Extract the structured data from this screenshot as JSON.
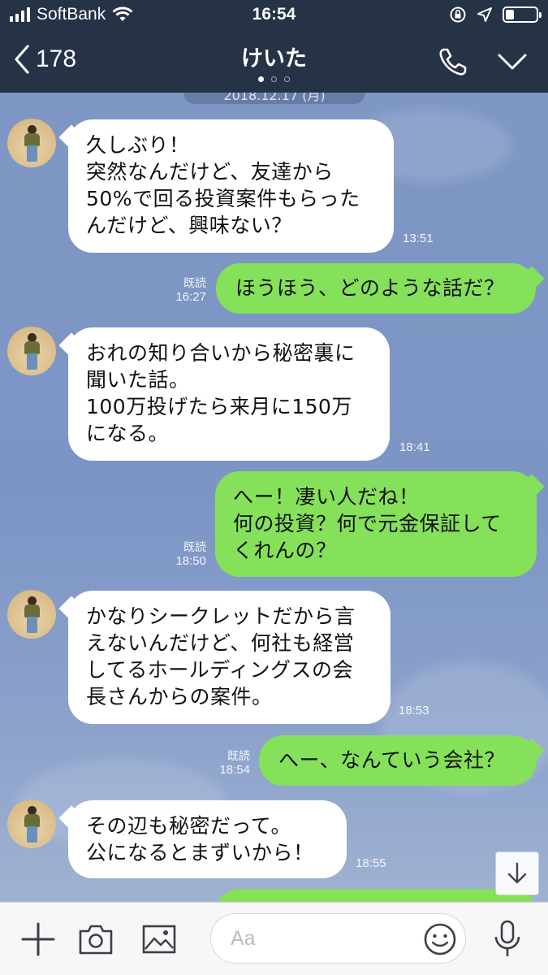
{
  "status_bar": {
    "carrier": "SoftBank",
    "time": "16:54",
    "signal_bars": 4,
    "battery_level_percent": 28,
    "icons": [
      "signal-icon",
      "wifi-icon",
      "orientation-lock-icon",
      "location-icon",
      "battery-icon"
    ]
  },
  "header": {
    "back_count": "178",
    "title": "けいた",
    "page_dots": 3,
    "active_dot": 0,
    "icons": [
      "back-chevron-icon",
      "phone-icon",
      "chevron-down-icon"
    ]
  },
  "chat": {
    "date_divider": "2018.12.17 (月)",
    "messages": [
      {
        "direction": "in",
        "lines": [
          "久しぶり！",
          "突然なんだけど、友達から",
          "50%で回る投資案件もらった",
          "んだけど、興味ない？"
        ],
        "time": "13:51"
      },
      {
        "direction": "out",
        "lines": [
          "ほうほう、どのような話だ？"
        ],
        "read": "既読",
        "time": "16:27"
      },
      {
        "direction": "in",
        "lines": [
          "おれの知り合いから秘密裏に",
          "聞いた話。",
          "100万投げたら来月に150万",
          "になる。"
        ],
        "time": "18:41"
      },
      {
        "direction": "out",
        "lines": [
          "へー！凄い人だね！",
          "何の投資？何で元金保証して",
          "くれんの？"
        ],
        "read": "既読",
        "time": "18:50"
      },
      {
        "direction": "in",
        "lines": [
          "かなりシークレットだから言",
          "えないんだけど、何社も経営",
          "してるホールディングスの会",
          "長さんからの案件。"
        ],
        "time": "18:53"
      },
      {
        "direction": "out",
        "lines": [
          "へー、なんていう会社？"
        ],
        "read": "既読",
        "time": "18:54"
      },
      {
        "direction": "in",
        "lines": [
          "その辺も秘密だって。",
          "公になるとまずいから！"
        ],
        "time": "18:55"
      }
    ]
  },
  "input_bar": {
    "placeholder": "Aa",
    "icons": [
      "plus-icon",
      "camera-icon",
      "image-icon",
      "emoji-icon",
      "microphone-icon"
    ]
  },
  "colors": {
    "header_bg": "#263246",
    "chat_bg": "#7b95c4",
    "incoming_bubble": "#ffffff",
    "outgoing_bubble": "#85e05a",
    "input_bar_bg": "#f7f7f8"
  }
}
